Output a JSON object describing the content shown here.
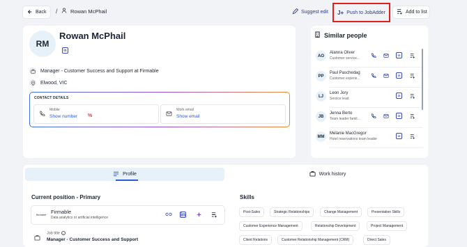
{
  "topbar": {
    "back_label": "Back",
    "separator": "/",
    "person_name": "Rowan McPhail",
    "suggest_edit": "Suggest edit",
    "push_label": "Push to JobAdder",
    "add_to_list": "Add to list"
  },
  "profile": {
    "initials": "RM",
    "name": "Rowan McPhail",
    "linkedin_glyph": "in",
    "position": "Manager - Customer Success and Support at Firmable",
    "location": "Elwood, VIC"
  },
  "contact": {
    "title": "CONTACT DETAILS",
    "mobile_label": "Mobile",
    "mobile_link": "Show number",
    "mobile_extra": "%",
    "email_label": "Work email",
    "email_link": "Show email"
  },
  "similar": {
    "title": "Similar people",
    "people": [
      {
        "initials": "AO",
        "name": "Alanna Oliver",
        "sub": "Customer service...",
        "phone": true,
        "email": true
      },
      {
        "initials": "PP",
        "name": "Paul Paschedag",
        "sub": "Customer experie...",
        "phone": true,
        "email": true
      },
      {
        "initials": "LJ",
        "name": "Leon Jory",
        "sub": "Service lead",
        "phone": false,
        "email": false
      },
      {
        "initials": "JB",
        "name": "Jenna Berto",
        "sub": "Team leader famil...",
        "phone": true,
        "email": true
      },
      {
        "initials": "MM",
        "name": "Melanie MacGregor",
        "sub": "Hotel reservations team leader",
        "phone": false,
        "email": false
      }
    ]
  },
  "tabs": {
    "profile": "Profile",
    "work_history": "Work history"
  },
  "current_position": {
    "title": "Current position - Primary",
    "company_logo": "firmable",
    "company": "Firmable",
    "industry": "Data analytics or artificial intelligence",
    "job_title_label": "Job title",
    "job_title": "Manager - Customer Success and Support"
  },
  "skills": {
    "title": "Skills",
    "items": [
      "Post-Sales",
      "Strategic Relationships",
      "Change Management",
      "Presentation Skills",
      "Customer Experience Management",
      "Relationship Development",
      "Project Management",
      "Client Relations",
      "Customer Relationship Management (CRM)",
      "Direct Sales"
    ]
  }
}
